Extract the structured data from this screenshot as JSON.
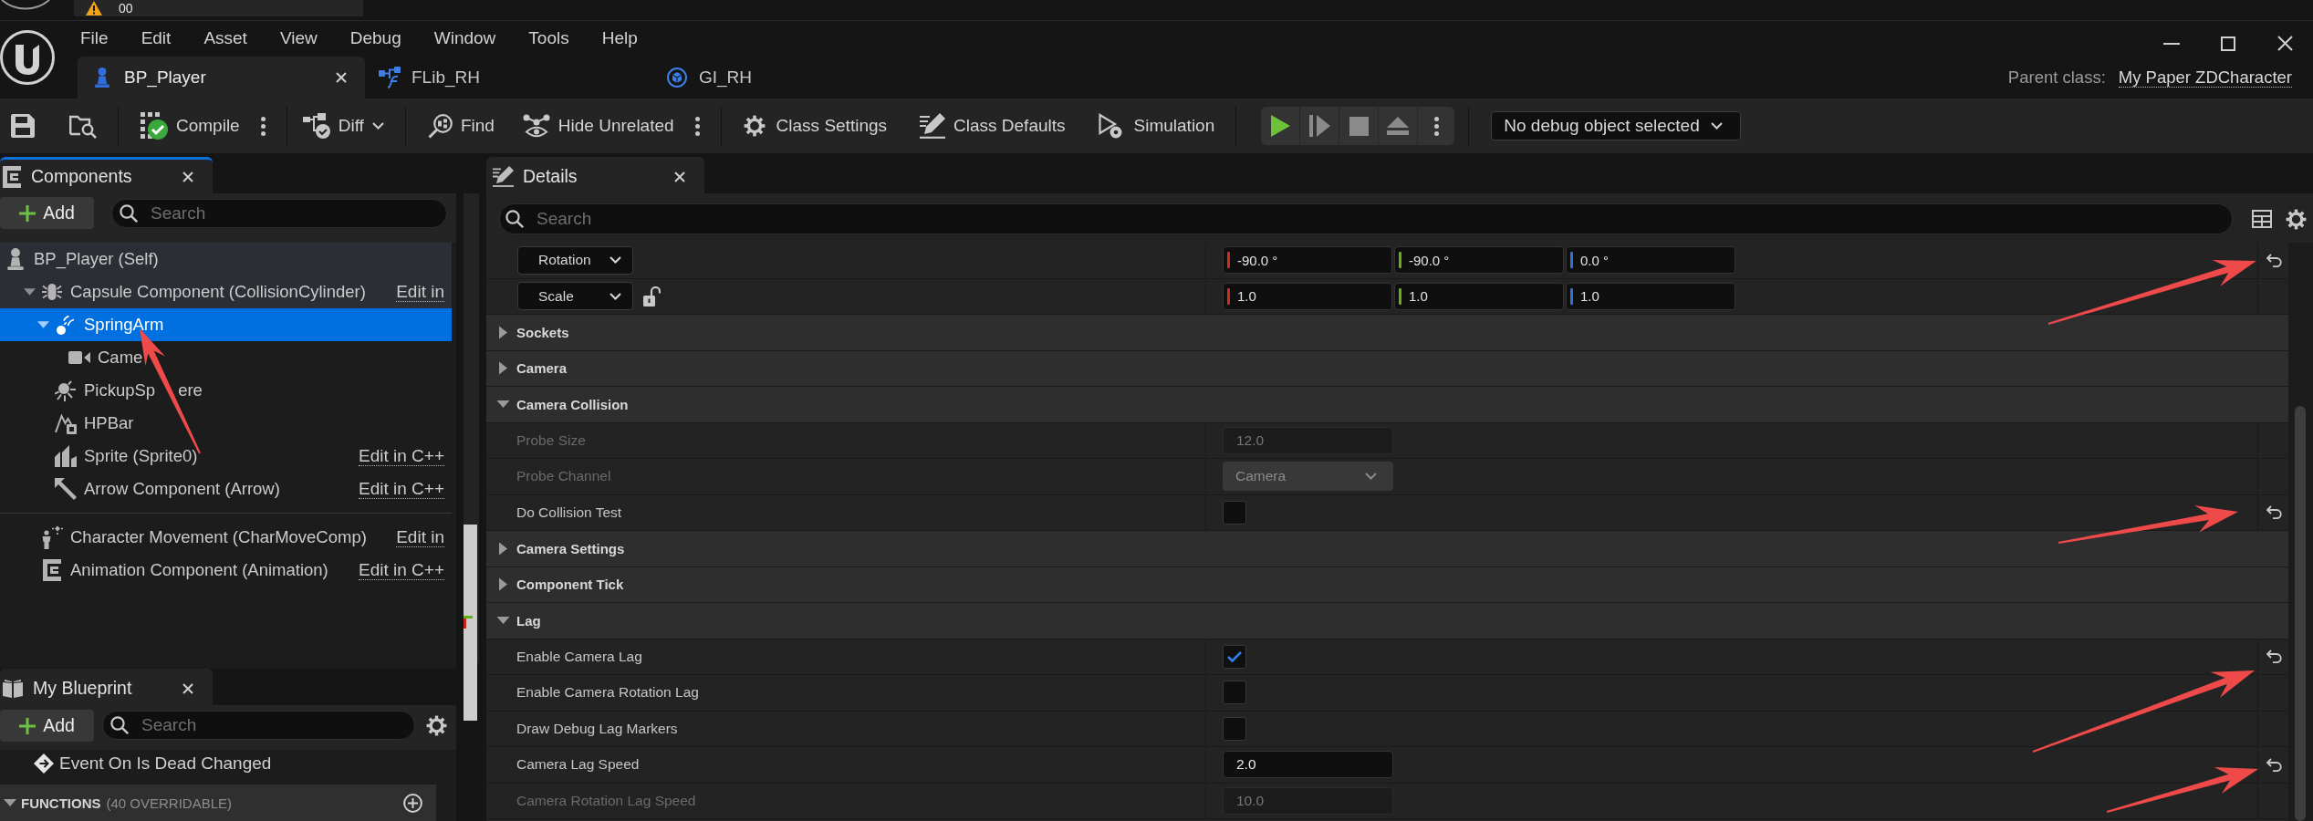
{
  "top_strip": {
    "tab": {
      "label": "00"
    }
  },
  "menu": [
    "File",
    "Edit",
    "Asset",
    "View",
    "Debug",
    "Window",
    "Tools",
    "Help"
  ],
  "document_tabs": [
    {
      "label": "BP_Player",
      "kind": "blueprint",
      "selected": true
    },
    {
      "label": "FLib_RH",
      "kind": "function_library",
      "selected": false
    },
    {
      "label": "GI_RH",
      "kind": "game_instance",
      "selected": false
    }
  ],
  "parent_class": {
    "label": "Parent class:",
    "value": "My Paper ZDCharacter"
  },
  "toolbar": [
    {
      "kind": "save"
    },
    {
      "kind": "browse"
    },
    {
      "kind": "separator"
    },
    {
      "kind": "compile",
      "label": "Compile"
    },
    {
      "kind": "more"
    },
    {
      "kind": "separator"
    },
    {
      "kind": "diff",
      "label": "Diff"
    },
    {
      "kind": "separator"
    },
    {
      "kind": "find",
      "label": "Find"
    },
    {
      "kind": "hide_unrelated",
      "label": "Hide Unrelated"
    },
    {
      "kind": "more"
    },
    {
      "kind": "separator"
    },
    {
      "kind": "class_settings",
      "label": "Class Settings"
    },
    {
      "kind": "class_defaults",
      "label": "Class Defaults"
    },
    {
      "kind": "simulation",
      "label": "Simulation"
    },
    {
      "kind": "separator"
    },
    {
      "kind": "play_controls"
    },
    {
      "kind": "separator"
    },
    {
      "kind": "debug_filter",
      "label": "No debug object selected"
    }
  ],
  "components": {
    "tab": {
      "title": "Components",
      "focused": true
    },
    "add_button": {
      "label": "Add"
    },
    "search": {
      "placeholder": "Search"
    },
    "tree": [
      {
        "label": "BP_Player (Self)",
        "kind": "actor",
        "selected": false,
        "children": [
          {
            "label": "Capsule Component (CollisionCylinder)",
            "kind": "capsule",
            "selected": false,
            "expanded": true,
            "edit_link": "Edit in",
            "children": [
              {
                "label": "SpringArm",
                "kind": "spring_arm",
                "selected": true,
                "expanded": true,
                "children": [
                  {
                    "label": "Came",
                    "kind": "camera",
                    "selected": false
                  }
                ]
              },
              {
                "label": "PickupSp",
                "label_end": "ere",
                "kind": "sphere",
                "selected": false
              },
              {
                "label": "HPBar",
                "kind": "widget",
                "selected": false
              },
              {
                "label": "Sprite (Sprite0)",
                "kind": "sprite",
                "selected": false,
                "edit_link": "Edit in C++"
              },
              {
                "label": "Arrow Component (Arrow)",
                "kind": "arrow",
                "selected": false,
                "edit_link": "Edit in C++"
              }
            ]
          }
        ]
      }
    ],
    "other": [
      {
        "label": "Character Movement (CharMoveComp)",
        "kind": "movement",
        "selected": false,
        "edit_link": "Edit in"
      },
      {
        "label": "Animation Component (Animation)",
        "kind": "animation",
        "selected": false,
        "edit_link": "Edit in C++"
      }
    ]
  },
  "my_blueprint": {
    "tab": {
      "title": "My Blueprint",
      "focused": false
    },
    "add_button": {
      "label": "Add"
    },
    "search": {
      "placeholder": "Search"
    },
    "items": [
      {
        "label": "Event On Is Dead Changed",
        "kind": "event"
      }
    ],
    "sections": [
      {
        "title": "FUNCTIONS",
        "count": "(40 OVERRIDABLE)",
        "expanded": true
      }
    ]
  },
  "details": {
    "tab": {
      "title": "Details",
      "focused": false
    },
    "search": {
      "placeholder": "Search"
    },
    "rows": [
      {
        "kind": "transform",
        "label": "Rotation",
        "values": [
          {
            "text": "-90.0 °",
            "color": "#c9301e"
          },
          {
            "text": "-90.0 °",
            "color": "#69ad17"
          },
          {
            "text": "0.0 °",
            "color": "#2c74d6"
          }
        ],
        "modified": true
      },
      {
        "kind": "transform",
        "label": "Scale",
        "locked": false,
        "values": [
          {
            "text": "1.0",
            "color": "#c9301e"
          },
          {
            "text": "1.0",
            "color": "#69ad17"
          },
          {
            "text": "1.0",
            "color": "#2c74d6"
          }
        ],
        "modified": false
      },
      {
        "kind": "category",
        "label": "Sockets",
        "expanded": false
      },
      {
        "kind": "category",
        "label": "Camera",
        "expanded": false
      },
      {
        "kind": "category",
        "label": "Camera Collision",
        "expanded": true,
        "properties": [
          {
            "kind": "number",
            "label": "Probe Size",
            "value": "12.0",
            "disabled": true,
            "modified": false
          },
          {
            "kind": "enum",
            "label": "Probe Channel",
            "value": "Camera",
            "disabled": true,
            "modified": false
          },
          {
            "kind": "checkbox",
            "label": "Do Collision Test",
            "checked": false,
            "disabled": false,
            "modified": true
          }
        ]
      },
      {
        "kind": "category",
        "label": "Camera Settings",
        "expanded": false
      },
      {
        "kind": "category",
        "label": "Component Tick",
        "expanded": false
      },
      {
        "kind": "category",
        "label": "Lag",
        "expanded": true,
        "properties": [
          {
            "kind": "checkbox",
            "label": "Enable Camera Lag",
            "checked": true,
            "disabled": false,
            "modified": true
          },
          {
            "kind": "checkbox",
            "label": "Enable Camera Rotation Lag",
            "checked": false,
            "disabled": false,
            "modified": false
          },
          {
            "kind": "checkbox",
            "label": "Draw Debug Lag Markers",
            "checked": false,
            "disabled": false,
            "modified": false
          },
          {
            "kind": "number",
            "label": "Camera Lag Speed",
            "value": "2.0",
            "disabled": false,
            "modified": true
          },
          {
            "kind": "number",
            "label": "Camera Rotation Lag Speed",
            "value": "10.0",
            "disabled": true,
            "modified": false
          }
        ]
      }
    ]
  }
}
